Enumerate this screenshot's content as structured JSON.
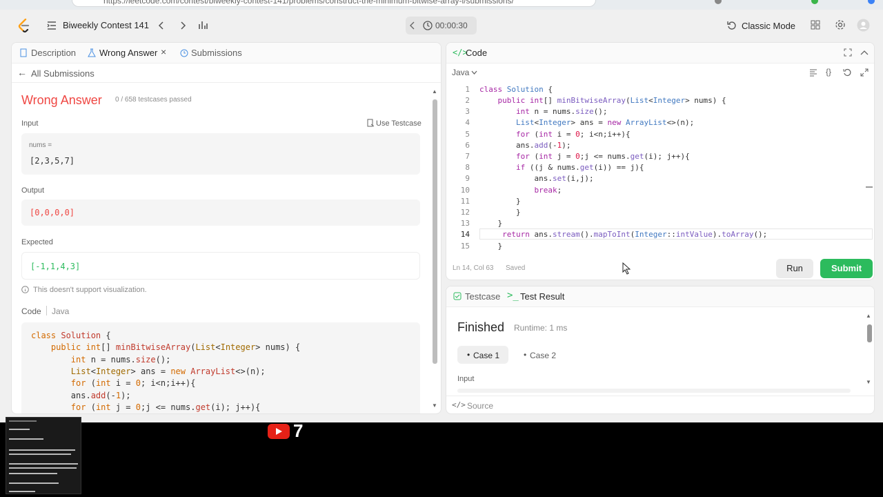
{
  "browser": {
    "url": "https://leetcode.com/contest/biweekly-contest-141/problems/construct-the-minimum-bitwise-array-i/submissions/"
  },
  "topnav": {
    "contest_title": "Biweekly Contest 141",
    "timer": "00:00:30",
    "mode_label": "Classic Mode"
  },
  "left": {
    "tabs": [
      "Description",
      "Wrong Answer",
      "Submissions"
    ],
    "back_label": "All Submissions",
    "verdict": "Wrong Answer",
    "testcases": "0 / 658 testcases passed",
    "input_label": "Input",
    "use_testcase": "Use Testcase",
    "input_var": "nums =",
    "input_value": "[2,3,5,7]",
    "output_label": "Output",
    "output_value": "[0,0,0,0]",
    "expected_label": "Expected",
    "expected_value": "[-1,1,4,3]",
    "viz_note": "This doesn't support visualization.",
    "code_label": "Code",
    "code_lang": "Java"
  },
  "code_panel": {
    "title": "Code",
    "language": "Java",
    "status_pos": "Ln 14, Col 63",
    "status_saved": "Saved",
    "run_label": "Run",
    "submit_label": "Submit"
  },
  "result_panel": {
    "tabs": [
      "Testcase",
      "Test Result"
    ],
    "status": "Finished",
    "runtime": "Runtime: 1 ms",
    "cases": [
      "Case 1",
      "Case 2"
    ],
    "input_label": "Input",
    "source_label": "Source"
  },
  "overlay": {
    "badge_number": "7"
  },
  "colors": {
    "wrong": "#ef4743",
    "accent_green": "#2cbb5d",
    "link_blue": "#007aff"
  }
}
